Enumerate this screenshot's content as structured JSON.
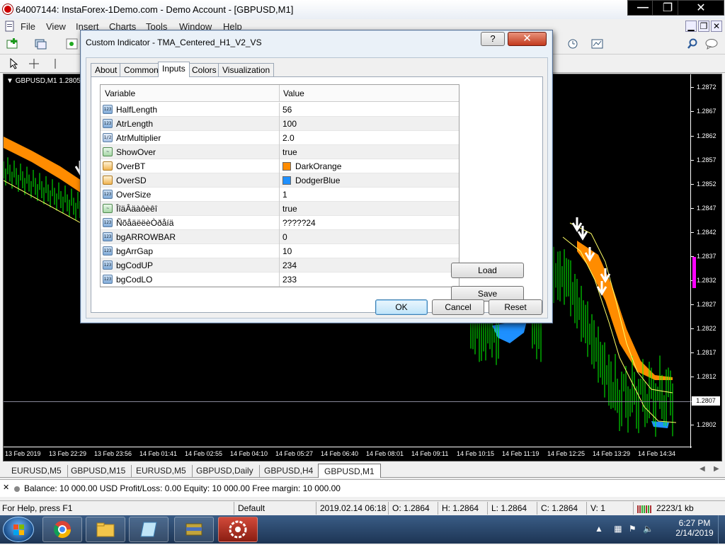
{
  "window": {
    "title": "64007144: InstaForex-1Demo.com - Demo Account - [GBPUSD,M1]"
  },
  "menu": [
    "File",
    "View",
    "Insert",
    "Charts",
    "Tools",
    "Window",
    "Help"
  ],
  "chart": {
    "symbol_label": "GBPUSD,M1  1.2805",
    "price_labels": [
      "1.2872",
      "1.2867",
      "1.2862",
      "1.2857",
      "1.2852",
      "1.2847",
      "1.2842",
      "1.2837",
      "1.2832",
      "1.2827",
      "1.2822",
      "1.2817",
      "1.2812",
      "1.2807",
      "1.2802"
    ],
    "current_price": "1.2807",
    "time_labels": [
      "13 Feb 2019",
      "13 Feb 22:29",
      "13 Feb 23:56",
      "14 Feb 01:41",
      "14 Feb 02:55",
      "14 Feb 04:10",
      "14 Feb 05:27",
      "14 Feb 06:40",
      "14 Feb 08:01",
      "14 Feb 09:11",
      "14 Feb 10:15",
      "14 Feb 11:19",
      "14 Feb 12:25",
      "14 Feb 13:29",
      "14 Feb 14:34"
    ],
    "colors": {
      "upper_band": "#ff8c00",
      "lower_band": "#1e90ff",
      "candles": "#00ff00",
      "center_line": "#ffff66"
    }
  },
  "dialog": {
    "title": "Custom Indicator - TMA_Centered_H1_V2_VS",
    "help_label": "?",
    "close_label": "✕",
    "tabs": [
      "About",
      "Common",
      "Inputs",
      "Colors",
      "Visualization"
    ],
    "active_tab": "Inputs",
    "columns": {
      "variable": "Variable",
      "value": "Value"
    },
    "rows": [
      {
        "icon": "int",
        "var": "HalfLength",
        "val": "56"
      },
      {
        "icon": "int",
        "var": "AtrLength",
        "val": "100"
      },
      {
        "icon": "double",
        "var": "AtrMultiplier",
        "val": "2.0"
      },
      {
        "icon": "bool",
        "var": "ShowOver",
        "val": "true"
      },
      {
        "icon": "color",
        "var": "OverBT",
        "val": "DarkOrange",
        "swatch": "#ff8c00"
      },
      {
        "icon": "color",
        "var": "OverSD",
        "val": "DodgerBlue",
        "swatch": "#1e90ff"
      },
      {
        "icon": "int",
        "var": "OverSize",
        "val": "1"
      },
      {
        "icon": "bool",
        "var": "ÎîäÂäàôèêî",
        "val": "true"
      },
      {
        "icon": "int",
        "var": "ÑõåäëëèÒðåíä",
        "val": "?????24"
      },
      {
        "icon": "int",
        "var": "bgARROWBAR",
        "val": "0"
      },
      {
        "icon": "int",
        "var": "bgArrGap",
        "val": "10"
      },
      {
        "icon": "int",
        "var": "bgCodUP",
        "val": "234"
      },
      {
        "icon": "int",
        "var": "bgCodLO",
        "val": "233"
      }
    ],
    "buttons": {
      "load": "Load",
      "save": "Save",
      "ok": "OK",
      "cancel": "Cancel",
      "reset": "Reset"
    }
  },
  "symbol_tabs": [
    "EURUSD,M5",
    "GBPUSD,M15",
    "EURUSD,M5",
    "GBPUSD,Daily",
    "GBPUSD,H4",
    "GBPUSD,M1"
  ],
  "active_symbol_tab": "GBPUSD,M1",
  "terminal": {
    "balance_text": "Balance: 10 000.00 USD  Profit/Loss: 0.00  Equity: 10 000.00  Free margin: 10 000.00"
  },
  "status": {
    "help": "For Help, press F1",
    "profile": "Default",
    "datetime": "2019.02.14 06:18",
    "open": "O: 1.2864",
    "high": "H: 1.2864",
    "low": "L: 1.2864",
    "close": "C: 1.2864",
    "volume": "V: 1",
    "traffic": "2223/1 kb"
  },
  "taskbar": {
    "time": "6:27 PM",
    "date": "2/14/2019"
  }
}
